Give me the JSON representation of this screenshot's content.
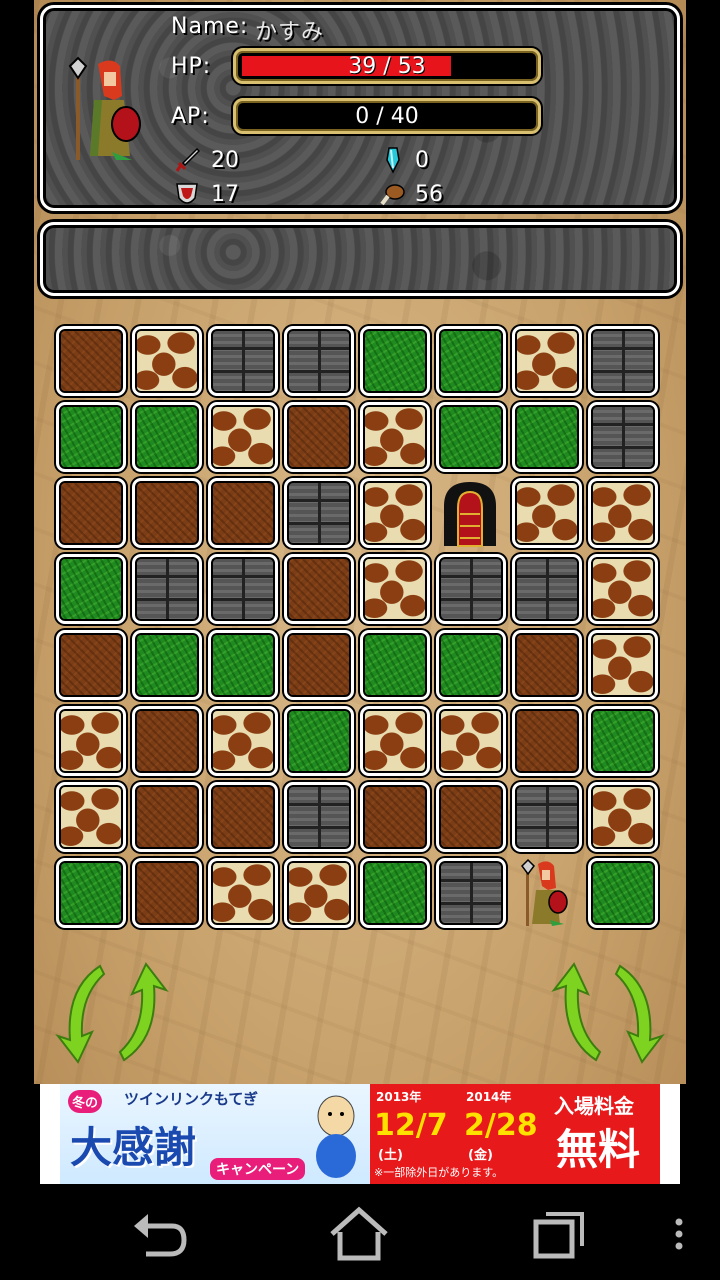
{
  "character": {
    "name_label": "Name:",
    "name": "かすみ",
    "hp_label": "HP:",
    "hp_current": 39,
    "hp_max": 53,
    "hp_text": "39 / 53",
    "ap_label": "AP:",
    "ap_current": 0,
    "ap_max": 40,
    "ap_text": "0 / 40",
    "stats": {
      "attack": "20",
      "gems": "0",
      "defense": "17",
      "food": "56"
    }
  },
  "message": "",
  "board": {
    "rows": [
      [
        "dirt",
        "spots",
        "stone",
        "stone",
        "grass",
        "grass",
        "spots",
        "stone"
      ],
      [
        "grass",
        "grass",
        "spots",
        "dirt",
        "spots",
        "grass",
        "grass",
        "stone"
      ],
      [
        "dirt",
        "dirt",
        "dirt",
        "stone",
        "spots",
        "door",
        "spots",
        "spots"
      ],
      [
        "grass",
        "stone",
        "stone",
        "dirt",
        "spots",
        "stone",
        "stone",
        "spots"
      ],
      [
        "dirt",
        "grass",
        "grass",
        "dirt",
        "grass",
        "grass",
        "dirt",
        "spots"
      ],
      [
        "spots",
        "dirt",
        "spots",
        "grass",
        "spots",
        "spots",
        "dirt",
        "grass"
      ],
      [
        "spots",
        "dirt",
        "dirt",
        "stone",
        "dirt",
        "dirt",
        "stone",
        "spots"
      ],
      [
        "grass",
        "dirt",
        "spots",
        "spots",
        "grass",
        "stone",
        "player",
        "grass"
      ]
    ]
  },
  "colors": {
    "hp_bar": "#e8141c",
    "arrow_green": "#7ed321",
    "bar_border": "#d8c070"
  },
  "ad": {
    "top_line": "ツインリンクもてぎ",
    "badge": "冬の",
    "main": "大感謝",
    "sub": "キャンペーン",
    "year1": "2013年",
    "date1": "12/7",
    "day1": "(土)",
    "year2": "2014年",
    "date2": "2/28",
    "day2": "(金)",
    "right_top": "入場料金",
    "right_main": "無料",
    "note": "※一部除外日があります。"
  }
}
